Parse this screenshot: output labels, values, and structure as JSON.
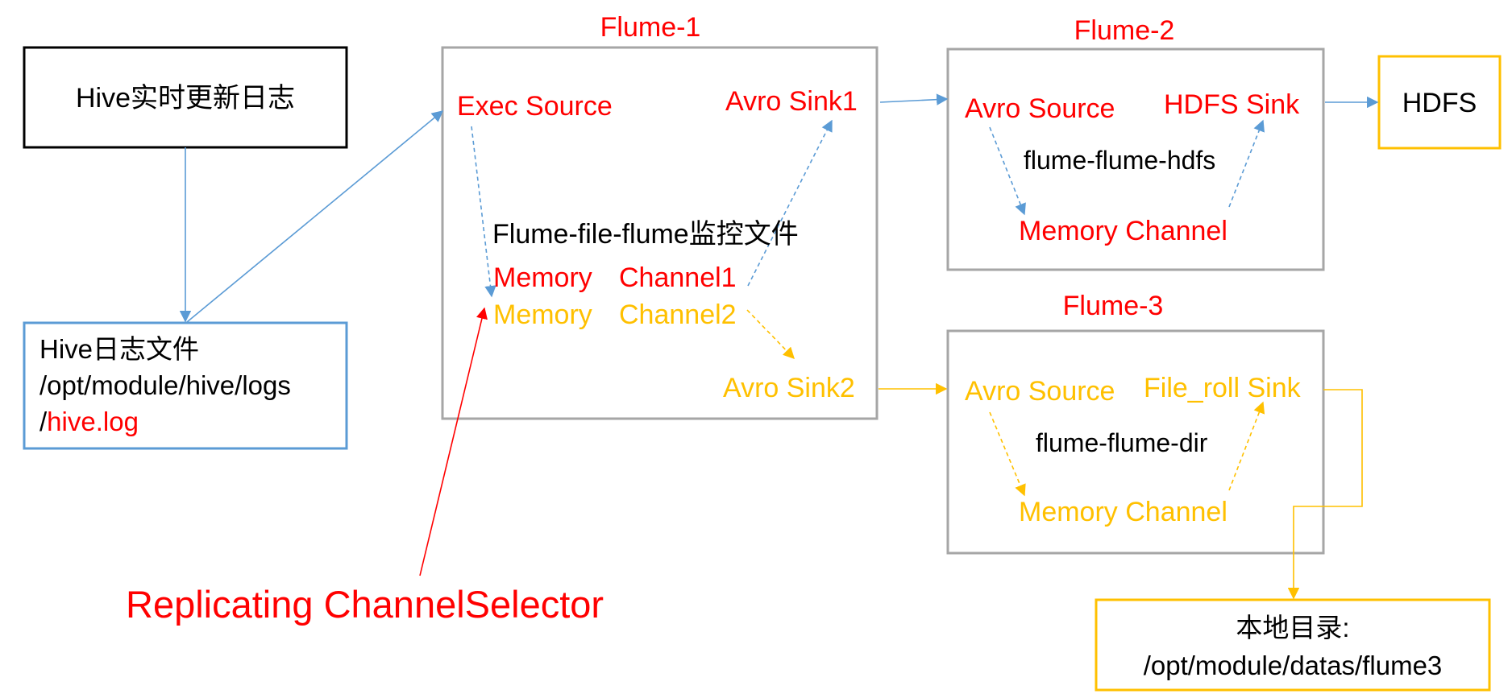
{
  "colors": {
    "red": "#ff0000",
    "yellow": "#ffc000",
    "blue": "#5b9bd5",
    "gray": "#a6a6a6",
    "black": "#000000"
  },
  "nodes": {
    "hive_log_source": {
      "label": "Hive实时更新日志"
    },
    "hive_log_file": {
      "line1": "Hive日志文件",
      "line2": "/opt/module/hive/logs",
      "line3_prefix": "/",
      "line3_highlight": "hive.log"
    },
    "flume1": {
      "title": "Flume-1",
      "exec_source": "Exec Source",
      "avro_sink1": "Avro Sink1",
      "description": "Flume-file-flume监控文件",
      "channel1_a": "Memory",
      "channel1_b": "Channel1",
      "channel2_a": "Memory",
      "channel2_b": "Channel2",
      "avro_sink2": "Avro Sink2"
    },
    "flume2": {
      "title": "Flume-2",
      "avro_source": "Avro Source",
      "hdfs_sink": "HDFS Sink",
      "description": "flume-flume-hdfs",
      "memory_channel": "Memory Channel"
    },
    "flume3": {
      "title": "Flume-3",
      "avro_source": "Avro Source",
      "file_roll_sink": "File_roll Sink",
      "description": "flume-flume-dir",
      "memory_channel": "Memory Channel"
    },
    "hdfs": {
      "label": "HDFS"
    },
    "local_dir": {
      "line1": "本地目录:",
      "line2": "/opt/module/datas/flume3"
    }
  },
  "annotation": {
    "selector_label": "Replicating ChannelSelector"
  }
}
